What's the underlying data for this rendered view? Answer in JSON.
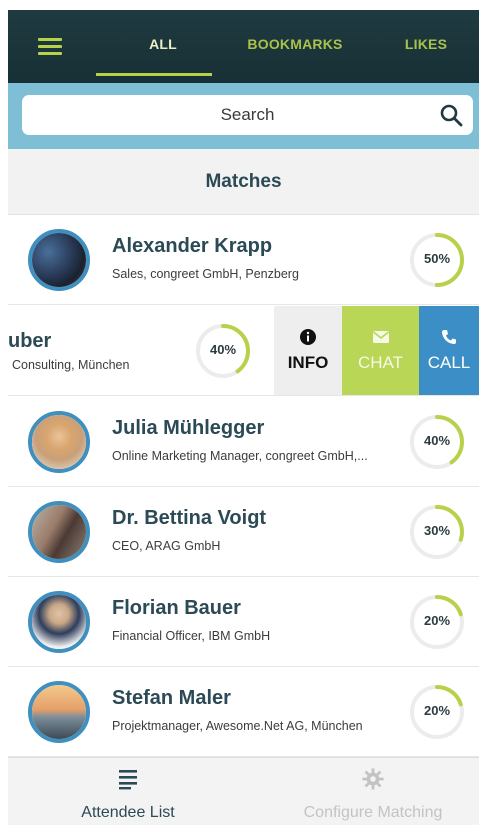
{
  "header": {
    "tabs": [
      {
        "label": "ALL",
        "active": true
      },
      {
        "label": "BOOKMARKS",
        "active": false
      },
      {
        "label": "LIKES",
        "active": false
      }
    ],
    "menu_icon": "hamburger-icon"
  },
  "search": {
    "placeholder": "Search",
    "icon": "search-icon"
  },
  "list": {
    "title": "Matches",
    "rows": [
      {
        "name": "Alexander Krapp",
        "subtitle": "Sales, congreet GmbH, Penzberg",
        "match_label": "50%",
        "match": 0.5
      },
      {
        "name": "Julia Mühlegger",
        "subtitle": "Online Marketing Manager, congreet GmbH,...",
        "match_label": "40%",
        "match": 0.4
      },
      {
        "name": "Dr. Bettina Voigt",
        "subtitle": "CEO, ARAG GmbH",
        "match_label": "30%",
        "match": 0.3
      },
      {
        "name": "Florian Bauer",
        "subtitle": "Financial Officer, IBM GmbH",
        "match_label": "20%",
        "match": 0.2
      },
      {
        "name": "Stefan Maler",
        "subtitle": "Projektmanager, Awesome.Net AG, München",
        "match_label": "20%",
        "match": 0.2
      }
    ],
    "swiped_row": {
      "name": "uber",
      "subtitle": "Consulting, München",
      "match_label": "40%",
      "match": 0.4,
      "actions": [
        {
          "label": "INFO",
          "icon": "info-icon"
        },
        {
          "label": "CHAT",
          "icon": "mail-icon"
        },
        {
          "label": "CALL",
          "icon": "phone-icon"
        }
      ]
    }
  },
  "bottom_nav": {
    "items": [
      {
        "label": "Attendee List",
        "icon": "list-icon",
        "active": true
      },
      {
        "label": "Configure Matching",
        "icon": "gear-icon",
        "active": false
      }
    ]
  },
  "colors": {
    "topbar": "#1f3a40",
    "accent_green": "#b7d24a",
    "search_band": "#7fbfd6",
    "avatar_ring": "#3f8fbf",
    "name_text": "#2b4a55",
    "chat": "#b9d657",
    "call": "#3c8fc6"
  }
}
